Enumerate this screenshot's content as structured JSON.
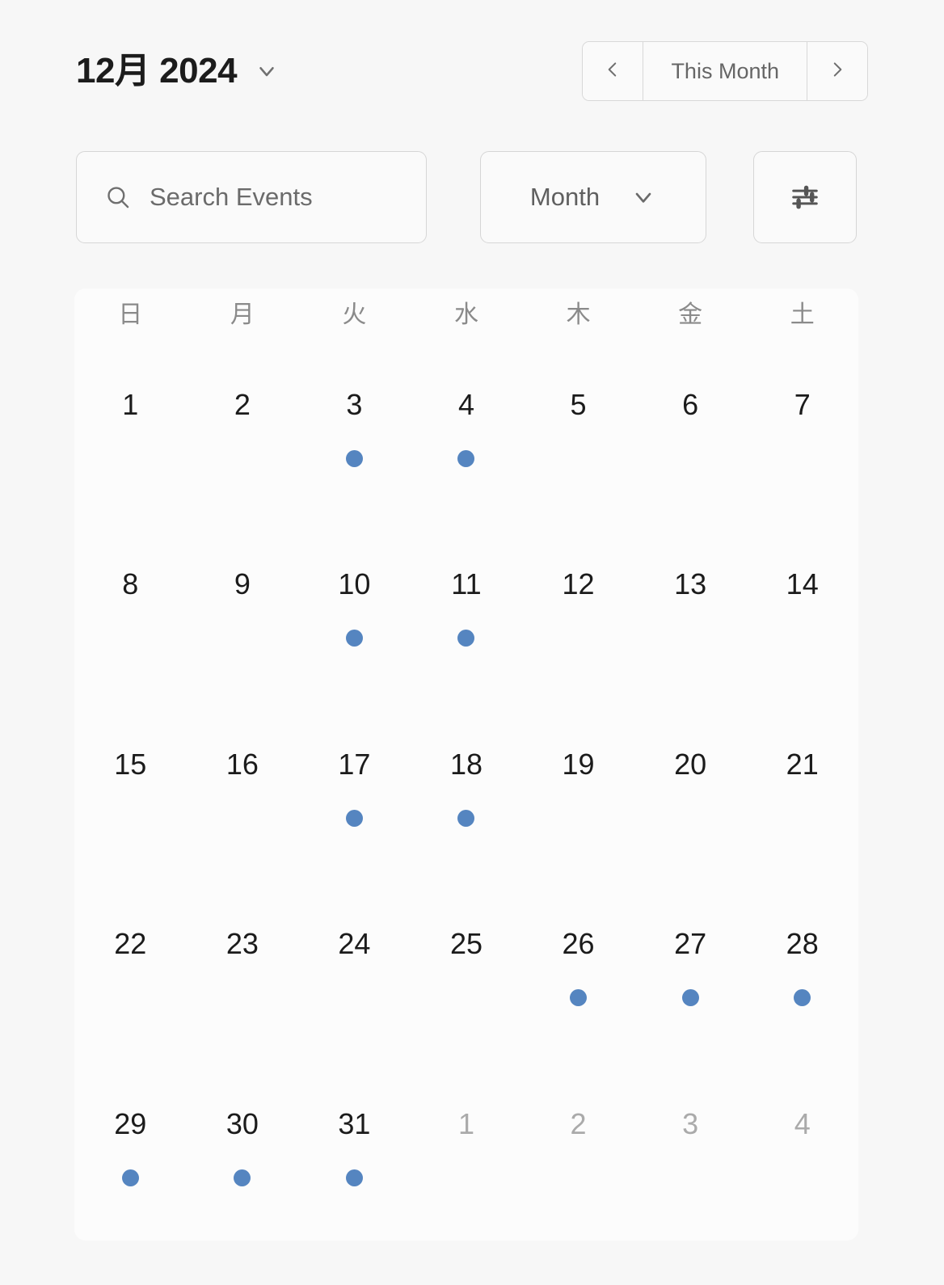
{
  "header": {
    "title": "12月 2024",
    "title_dropdown_icon": "chevron-down-icon",
    "nav": {
      "prev_icon": "chevron-left-icon",
      "label": "This Month",
      "next_icon": "chevron-right-icon"
    }
  },
  "toolbar": {
    "search": {
      "icon": "search-icon",
      "placeholder": "Search Events",
      "value": ""
    },
    "view_select": {
      "selected": "Month",
      "icon": "chevron-down-icon",
      "options": [
        "Month"
      ]
    },
    "filter_button": {
      "icon": "sliders-icon"
    }
  },
  "calendar": {
    "weekdays": [
      "日",
      "月",
      "火",
      "水",
      "木",
      "金",
      "土"
    ],
    "accent_color": "#5585c0",
    "muted_color": "#aaaaaa",
    "weeks": [
      [
        {
          "day": "1",
          "muted": false,
          "event": false
        },
        {
          "day": "2",
          "muted": false,
          "event": false
        },
        {
          "day": "3",
          "muted": false,
          "event": true
        },
        {
          "day": "4",
          "muted": false,
          "event": true
        },
        {
          "day": "5",
          "muted": false,
          "event": false
        },
        {
          "day": "6",
          "muted": false,
          "event": false
        },
        {
          "day": "7",
          "muted": false,
          "event": false
        }
      ],
      [
        {
          "day": "8",
          "muted": false,
          "event": false
        },
        {
          "day": "9",
          "muted": false,
          "event": false
        },
        {
          "day": "10",
          "muted": false,
          "event": true
        },
        {
          "day": "11",
          "muted": false,
          "event": true
        },
        {
          "day": "12",
          "muted": false,
          "event": false
        },
        {
          "day": "13",
          "muted": false,
          "event": false
        },
        {
          "day": "14",
          "muted": false,
          "event": false
        }
      ],
      [
        {
          "day": "15",
          "muted": false,
          "event": false
        },
        {
          "day": "16",
          "muted": false,
          "event": false
        },
        {
          "day": "17",
          "muted": false,
          "event": true
        },
        {
          "day": "18",
          "muted": false,
          "event": true
        },
        {
          "day": "19",
          "muted": false,
          "event": false
        },
        {
          "day": "20",
          "muted": false,
          "event": false
        },
        {
          "day": "21",
          "muted": false,
          "event": false
        }
      ],
      [
        {
          "day": "22",
          "muted": false,
          "event": false
        },
        {
          "day": "23",
          "muted": false,
          "event": false
        },
        {
          "day": "24",
          "muted": false,
          "event": false
        },
        {
          "day": "25",
          "muted": false,
          "event": false
        },
        {
          "day": "26",
          "muted": false,
          "event": true
        },
        {
          "day": "27",
          "muted": false,
          "event": true
        },
        {
          "day": "28",
          "muted": false,
          "event": true
        }
      ],
      [
        {
          "day": "29",
          "muted": false,
          "event": true
        },
        {
          "day": "30",
          "muted": false,
          "event": true
        },
        {
          "day": "31",
          "muted": false,
          "event": true
        },
        {
          "day": "1",
          "muted": true,
          "event": false
        },
        {
          "day": "2",
          "muted": true,
          "event": false
        },
        {
          "day": "3",
          "muted": true,
          "event": false
        },
        {
          "day": "4",
          "muted": true,
          "event": false
        }
      ]
    ]
  }
}
